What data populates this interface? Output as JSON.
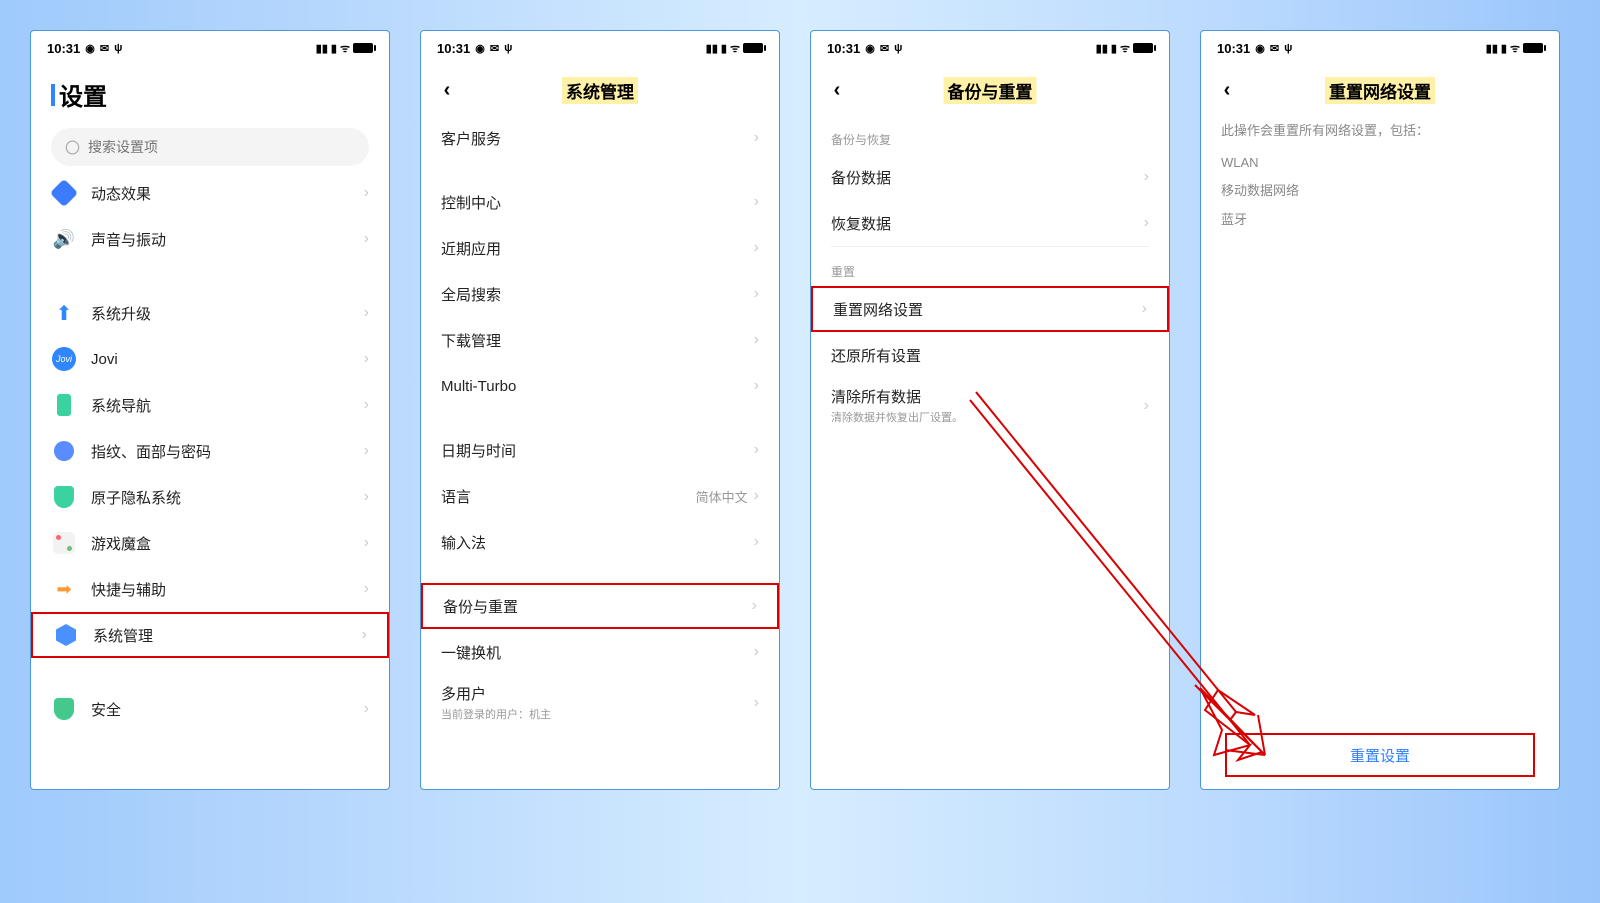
{
  "statusbar": {
    "time": "10:31"
  },
  "screen1": {
    "title": "设置",
    "search_placeholder": "搜索设置项",
    "items": {
      "dynamic": "动态效果",
      "sound": "声音与振动",
      "upgrade": "系统升级",
      "jovi": "Jovi",
      "nav": "系统导航",
      "finger": "指纹、面部与密码",
      "atom": "原子隐私系统",
      "game": "游戏魔盒",
      "shortcut": "快捷与辅助",
      "sysmgr": "系统管理",
      "security": "安全"
    }
  },
  "screen2": {
    "title": "系统管理",
    "items": {
      "service": "客户服务",
      "control": "控制中心",
      "recent": "近期应用",
      "search": "全局搜索",
      "download": "下载管理",
      "multi": "Multi-Turbo",
      "date": "日期与时间",
      "lang": "语言",
      "lang_val": "简体中文",
      "input": "输入法",
      "backup": "备份与重置",
      "switch": "一键换机",
      "multiuser": "多用户",
      "multiuser_sub": "当前登录的用户：机主"
    }
  },
  "screen3": {
    "title": "备份与重置",
    "group1": "备份与恢复",
    "items": {
      "backup_data": "备份数据",
      "restore": "恢复数据"
    },
    "group2": "重置",
    "items2": {
      "reset_net": "重置网络设置",
      "reset_all": "还原所有设置",
      "clear": "清除所有数据",
      "clear_sub": "清除数据并恢复出厂设置。"
    }
  },
  "screen4": {
    "title": "重置网络设置",
    "desc": "此操作会重置所有网络设置，包括：",
    "lines": {
      "wlan": "WLAN",
      "mobile": "移动数据网络",
      "bt": "蓝牙"
    },
    "button": "重置设置"
  }
}
